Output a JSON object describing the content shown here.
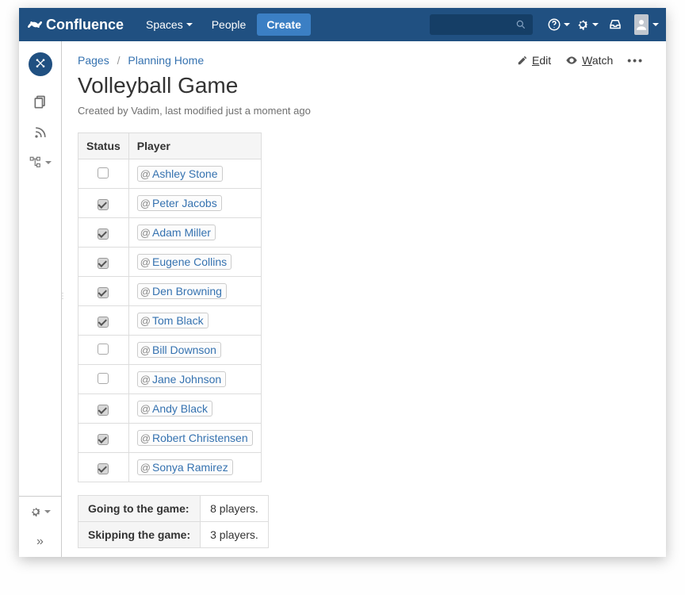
{
  "nav": {
    "brand": "Confluence",
    "spaces": "Spaces",
    "people": "People",
    "create": "Create"
  },
  "actions": {
    "edit": "Edit",
    "watch": "Watch"
  },
  "breadcrumb": {
    "pages": "Pages",
    "home": "Planning Home"
  },
  "page": {
    "title": "Volleyball Game",
    "meta": "Created by Vadim, last modified just a moment ago"
  },
  "table": {
    "status_header": "Status",
    "player_header": "Player"
  },
  "players": [
    {
      "checked": false,
      "name": "Ashley Stone"
    },
    {
      "checked": true,
      "name": "Peter Jacobs"
    },
    {
      "checked": true,
      "name": "Adam Miller"
    },
    {
      "checked": true,
      "name": "Eugene Collins"
    },
    {
      "checked": true,
      "name": "Den Browning"
    },
    {
      "checked": true,
      "name": "Tom Black"
    },
    {
      "checked": false,
      "name": "Bill Downson"
    },
    {
      "checked": false,
      "name": "Jane Johnson"
    },
    {
      "checked": true,
      "name": "Andy Black"
    },
    {
      "checked": true,
      "name": "Robert Christensen"
    },
    {
      "checked": true,
      "name": "Sonya Ramirez"
    }
  ],
  "summary": {
    "going_label": "Going to the game:",
    "going_value": "8 players.",
    "skip_label": "Skipping the game:",
    "skip_value": "3 players."
  }
}
